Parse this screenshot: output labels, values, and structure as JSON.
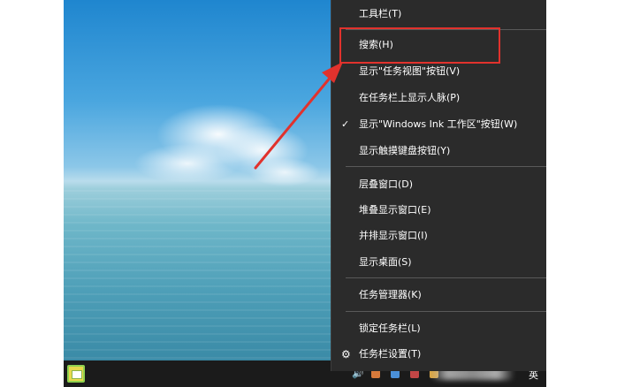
{
  "context_menu": {
    "items": [
      {
        "label": "工具栏(T)"
      },
      {
        "label": "搜索(H)"
      },
      {
        "label": "显示\"任务视图\"按钮(V)"
      },
      {
        "label": "在任务栏上显示人脉(P)"
      },
      {
        "label": "显示\"Windows Ink 工作区\"按钮(W)",
        "checked": true
      },
      {
        "label": "显示触摸键盘按钮(Y)"
      },
      {
        "label": "层叠窗口(D)"
      },
      {
        "label": "堆叠显示窗口(E)"
      },
      {
        "label": "并排显示窗口(I)"
      },
      {
        "label": "显示桌面(S)"
      },
      {
        "label": "任务管理器(K)"
      },
      {
        "label": "锁定任务栏(L)"
      },
      {
        "label": "任务栏设置(T)"
      }
    ]
  },
  "icons": {
    "check": "✓",
    "gear": "⚙",
    "speaker": "🔊"
  },
  "taskbar": {
    "ime_label": "英"
  },
  "annotation": {
    "highlight_color": "#e1322d"
  }
}
